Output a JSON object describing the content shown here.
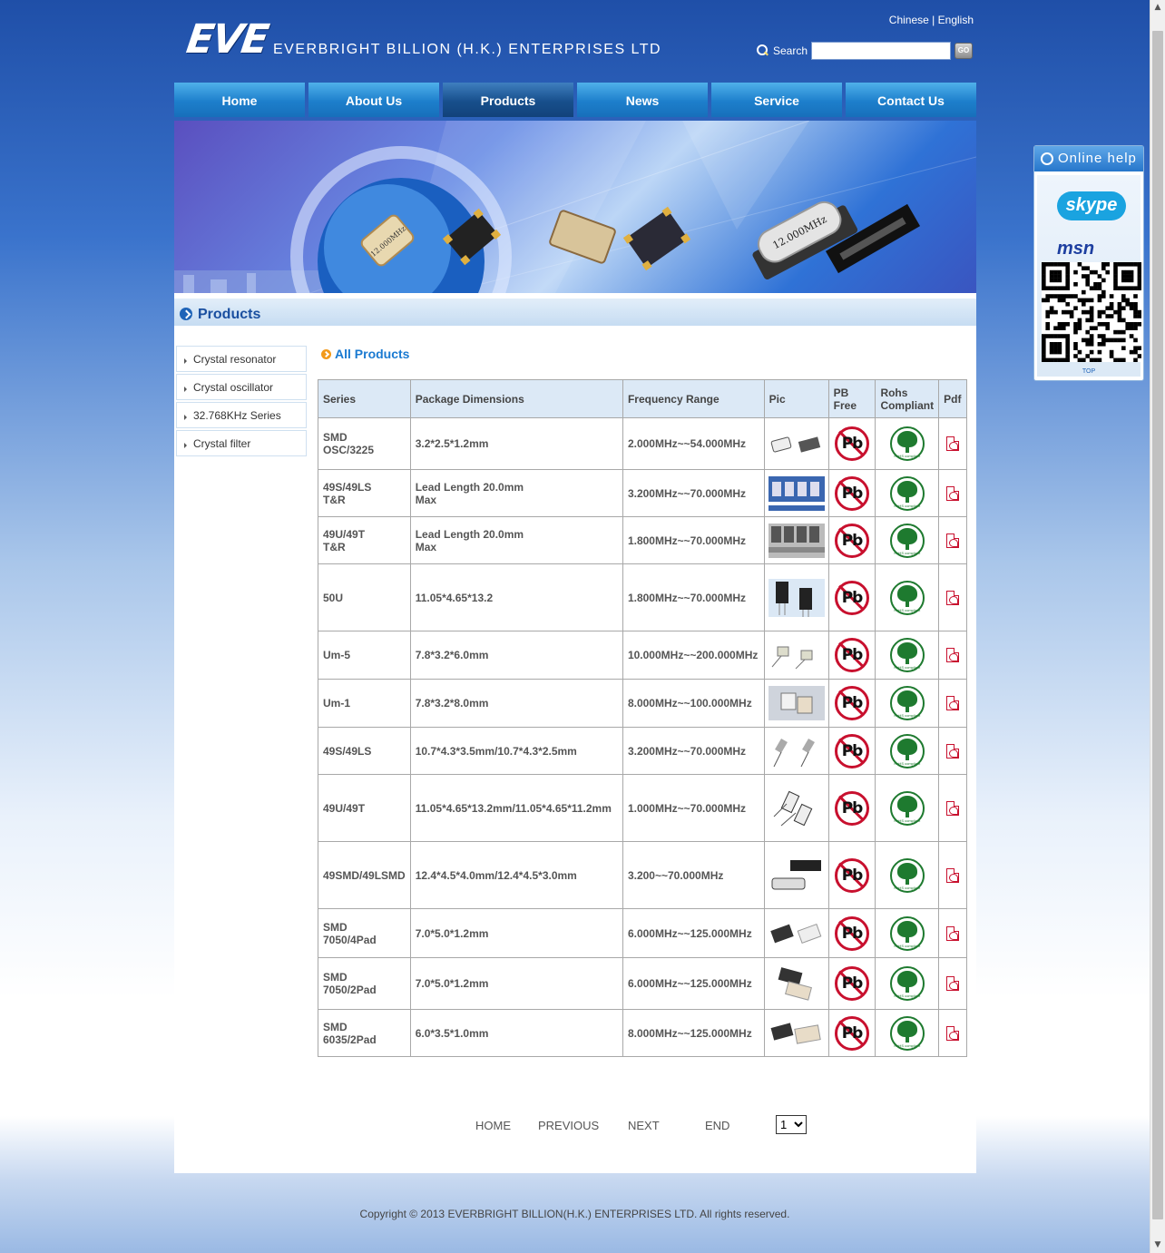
{
  "header": {
    "logo_text": "EVE",
    "company_name": "EVERBRIGHT BILLION (H.K.) ENTERPRISES LTD",
    "lang_chinese": "Chinese",
    "lang_sep": "|",
    "lang_english": "English",
    "search_label": "Search",
    "search_value": "",
    "go_label": "GO"
  },
  "nav": [
    {
      "label": "Home"
    },
    {
      "label": "About Us"
    },
    {
      "label": "Products"
    },
    {
      "label": "News"
    },
    {
      "label": "Service"
    },
    {
      "label": "Contact Us"
    }
  ],
  "banner": {
    "crystal_label": "12.000MHz"
  },
  "section": {
    "title": "Products"
  },
  "sidebar": [
    {
      "label": "Crystal resonator"
    },
    {
      "label": "Crystal oscillator"
    },
    {
      "label": "32.768KHz Series"
    },
    {
      "label": "Crystal filter"
    }
  ],
  "all_products_label": "All Products",
  "table": {
    "headers": {
      "series": "Series",
      "package": "Package Dimensions",
      "frequency": "Frequency Range",
      "pic": "Pic",
      "pb_line1": "PB",
      "pb_line2": "Free",
      "rohs_line1": "Rohs",
      "rohs_line2": "Compliant",
      "pdf": "Pdf"
    },
    "pb_text": "Pb",
    "rohs_text": "RoHS compliant",
    "rows": [
      {
        "series1": "SMD",
        "series2": "OSC/3225",
        "package1": "3.2*2.5*1.2mm",
        "package2": "",
        "frequency": "2.000MHz~~54.000MHz"
      },
      {
        "series1": "49S/49LS",
        "series2": "T&R",
        "package1": "Lead Length 20.0mm",
        "package2": "Max",
        "frequency": "3.200MHz~~70.000MHz"
      },
      {
        "series1": "49U/49T",
        "series2": "T&R",
        "package1": "Lead Length 20.0mm",
        "package2": "Max",
        "frequency": "1.800MHz~~70.000MHz"
      },
      {
        "series1": "50U",
        "series2": "",
        "package1": "11.05*4.65*13.2",
        "package2": "",
        "frequency": "1.800MHz~~70.000MHz"
      },
      {
        "series1": "Um-5",
        "series2": "",
        "package1": "7.8*3.2*6.0mm",
        "package2": "",
        "frequency": "10.000MHz~~200.000MHz"
      },
      {
        "series1": "Um-1",
        "series2": "",
        "package1": "7.8*3.2*8.0mm",
        "package2": "",
        "frequency": "8.000MHz~~100.000MHz"
      },
      {
        "series1": "49S/49LS",
        "series2": "",
        "package1": "10.7*4.3*3.5mm/10.7*4.3*2.5mm",
        "package2": "",
        "frequency": "3.200MHz~~70.000MHz"
      },
      {
        "series1": "49U/49T",
        "series2": "",
        "package1": "11.05*4.65*13.2mm/11.05*4.65*11.2mm",
        "package2": "",
        "frequency": "1.000MHz~~70.000MHz"
      },
      {
        "series1": "49SMD/49LSMD",
        "series2": "",
        "package1": "12.4*4.5*4.0mm/12.4*4.5*3.0mm",
        "package2": "",
        "frequency": "3.200~~70.000MHz"
      },
      {
        "series1": "SMD",
        "series2": "7050/4Pad",
        "package1": "7.0*5.0*1.2mm",
        "package2": "",
        "frequency": "6.000MHz~~125.000MHz"
      },
      {
        "series1": "SMD",
        "series2": "7050/2Pad",
        "package1": "7.0*5.0*1.2mm",
        "package2": "",
        "frequency": "6.000MHz~~125.000MHz"
      },
      {
        "series1": "SMD",
        "series2": "6035/2Pad",
        "package1": "6.0*3.5*1.0mm",
        "package2": "",
        "frequency": "8.000MHz~~125.000MHz"
      }
    ]
  },
  "pager": {
    "home": "HOME",
    "previous": "PREVIOUS",
    "next": "NEXT",
    "end": "END",
    "page_value": "1"
  },
  "footer": {
    "copyright": "Copyright © 2013 EVERBRIGHT BILLION(H.K.) ENTERPRISES LTD. All rights reserved."
  },
  "online_help": {
    "title": "Online help",
    "skype_label": "skype",
    "msn_label": "msn",
    "top_label": "TOP"
  },
  "colors": {
    "nav_blue": "#1d7fcc",
    "nav_active": "#174f8c",
    "title_blue": "#1a4fa0",
    "accent_orange": "#f29a1b",
    "pb_red": "#c8102e",
    "rohs_green": "#1e7a2f"
  }
}
